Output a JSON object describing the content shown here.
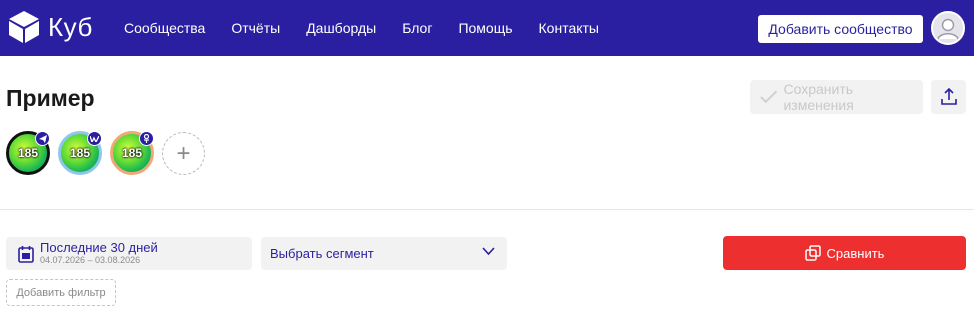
{
  "brand": {
    "name": "Куб",
    "logo_icon": "cube-icon"
  },
  "nav": {
    "items": [
      {
        "label": "Сообщества"
      },
      {
        "label": "Отчёты"
      },
      {
        "label": "Дашборды"
      },
      {
        "label": "Блог"
      },
      {
        "label": "Помощь"
      },
      {
        "label": "Контакты"
      }
    ],
    "add_community_label": "Добавить сообщество"
  },
  "page": {
    "title": "Пример"
  },
  "toolbar": {
    "save_label": "Сохранить изменения",
    "upload_icon": "upload-icon"
  },
  "sources": [
    {
      "value": "185",
      "badge_icon": "telegram-icon"
    },
    {
      "value": "185",
      "badge_icon": "vk-icon"
    },
    {
      "value": "185",
      "badge_icon": "ok-icon"
    }
  ],
  "add_source_label": "+",
  "filters": {
    "date": {
      "label": "Последние 30 дней",
      "range": "04.07.2026 – 03.08.2026"
    },
    "segment": {
      "placeholder": "Выбрать сегмент"
    },
    "compare_label": "Сравнить",
    "add_filter_label": "Добавить фильтр"
  },
  "colors": {
    "brand": "#2a1fa0",
    "accent_red": "#ee2f2f",
    "muted_bg": "#f2f2f2"
  }
}
